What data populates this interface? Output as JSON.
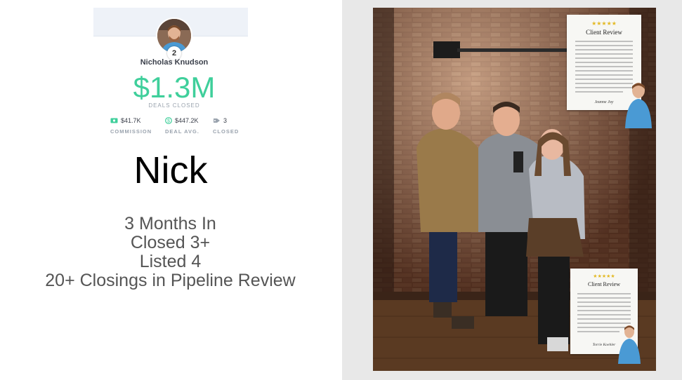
{
  "leaderboard": {
    "rank": "2",
    "name": "Nicholas Knudson",
    "deals_closed_value": "$1.3M",
    "deals_closed_label": "DEALS CLOSED",
    "commission_value": "$41.7K",
    "commission_label": "COMMISSION",
    "deal_avg_value": "$447.2K",
    "deal_avg_label": "DEAL AVG.",
    "closed_value": "3",
    "closed_label": "CLOSED",
    "accent_color": "#3fcf9b"
  },
  "title": "Nick",
  "summary": [
    "3 Months In",
    "Closed 3+",
    "Listed 4",
    "20+ Closings in Pipeline Review"
  ],
  "reviews": {
    "top": {
      "stars": "★★★★★",
      "title": "Client Review",
      "body": "Nick was amazing. He made buying a new home extremely pain free. He gave us sound advice on every decision! I just can't say enough good things about him if you are buying or selling he's the best realtor I've ever dealt with!!! This the 4th home we have purchased in the last 15 years and by far he is the best realtor I have ever had the pleasure of working with!",
      "signature": "Jeanne Joy"
    },
    "bottom": {
      "stars": "★★★★★",
      "title": "Client Review",
      "body": "Nick was great, we were selling our home to cut with, the lender when we close last minute, Nick was very patient and we are very grateful. Nick was a great realtor, I would have recommend him to any, and made it to the finish line with us and we are closing and even if with our, we, lastly thanks to him!!!",
      "signature": "Torrie Koehler"
    }
  }
}
